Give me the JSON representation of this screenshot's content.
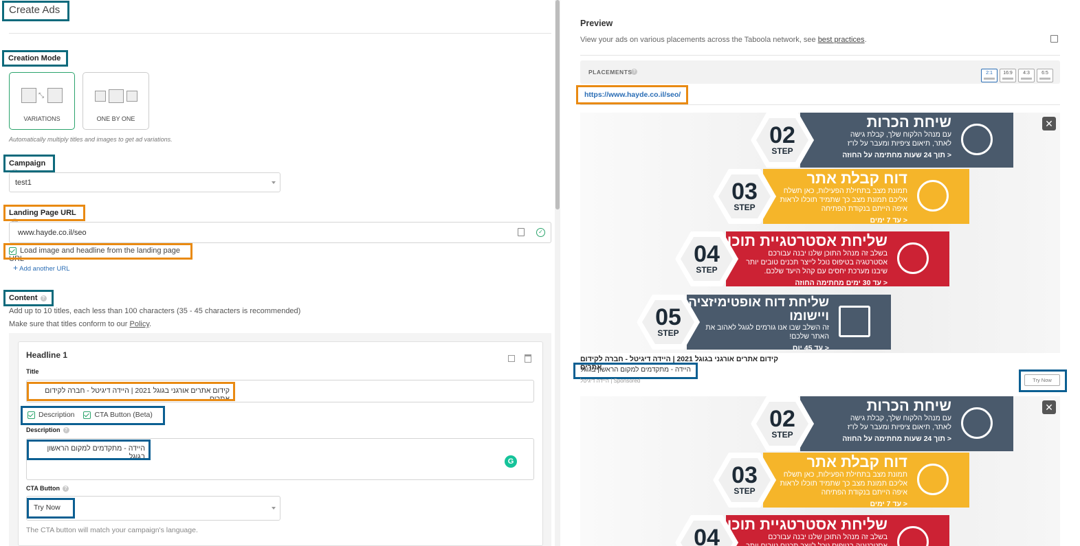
{
  "left": {
    "page_title": "Create Ads",
    "creation_mode": {
      "label": "Creation Mode",
      "options": [
        {
          "label": "VARIATIONS"
        },
        {
          "label": "ONE BY ONE"
        }
      ],
      "hint": "Automatically multiply titles and images to get ad variations."
    },
    "campaign": {
      "label": "Campaign",
      "value": "test1"
    },
    "landing": {
      "label": "Landing Page URL",
      "value": "www.hayde.co.il/seo",
      "load_checkbox": "Load image and headline from the landing page URL",
      "add_url": "Add another URL"
    },
    "content": {
      "label": "Content",
      "hint1": "Add up to 10 titles, each less than 100 characters (35 - 45 characters is recommended)",
      "hint2_pre": "Make sure that titles conform to our",
      "hint2_link": "Policy",
      "hint2_post": "."
    },
    "headline": {
      "heading": "Headline 1",
      "title_label": "Title",
      "title_value": "קידום אתרים אורגני בגוגל 2021 | היידה דיגיטל - חברה לקידום אתרים",
      "desc_check": "Description",
      "cta_check": "CTA Button (Beta)",
      "desc_label": "Description",
      "desc_value": "היידה - מתקדמים למקום הראשון בגוגל",
      "cta_label": "CTA Button",
      "cta_value": "Try Now",
      "cta_hint": "The CTA button will match your campaign's language."
    }
  },
  "preview": {
    "title": "Preview",
    "subtitle_pre": "View your ads on various placements across the Taboola network, see",
    "subtitle_link": "best practices",
    "subtitle_post": ".",
    "placements_label": "PLACEMENTS",
    "ratios": [
      "2:1",
      "16:9",
      "4:3",
      "6:5"
    ],
    "url": "https://www.hayde.co.il/seo/",
    "ad_title": "קידום אתרים אורגני בגוגל 2021 | היידה דיגיטל - חברה לקידום אתרים",
    "ad_desc": "היידה - מתקדמים למקום הראשון בגוגל",
    "sponsored": "היידה דיגיטל | Sponsored",
    "cta": "Try Now",
    "close": "✕",
    "steps": [
      {
        "num": "02",
        "step": "STEP",
        "title": "שיחת הכרות",
        "l1": "עם מנהל הלקוח שלך, קבלת גישה",
        "l2": "לאתר, תיאום ציפיות ומעבר על לו\"ז",
        "l3": "",
        "bold": "< תוך 24 שעות מחתימה על החוזה",
        "color": "#4a5a6c"
      },
      {
        "num": "03",
        "step": "STEP",
        "title": "דוח קבלת אתר",
        "l1": "תמונת מצב בתחילת הפעילות, כאן תשלח",
        "l2": "אליכם תמונת מצב כך שתמיד תוכלו לראות",
        "l3": "איפה הייתם בנקודת הפתיחה",
        "bold": "< עד 7 ימים",
        "color": "#f5b52a"
      },
      {
        "num": "04",
        "step": "STEP",
        "title": "שליחת אסטרטגיית תוכן",
        "l1": "בשלב זה מנהל התוכן שלנו יבנה עבורכם",
        "l2": "אסטרטגיה בטיפוס נוכל לייצר תכנים טובים יותר",
        "l3": "שיבנו מערכת יחסים עם קהל היעד שלכם.",
        "bold": "< עד 30 ימים מחתימה החוזה",
        "color": "#cc2234"
      },
      {
        "num": "05",
        "step": "STEP",
        "title": "שליחת דוח אופטימיזציה ויישומו",
        "l1": "זה השלב שבו אנו גורמים לגוגל לאהוב את",
        "l2": "האתר שלכם!",
        "l3": "",
        "bold": "< עד 45 יום",
        "color": "#4a5a6c"
      }
    ]
  }
}
